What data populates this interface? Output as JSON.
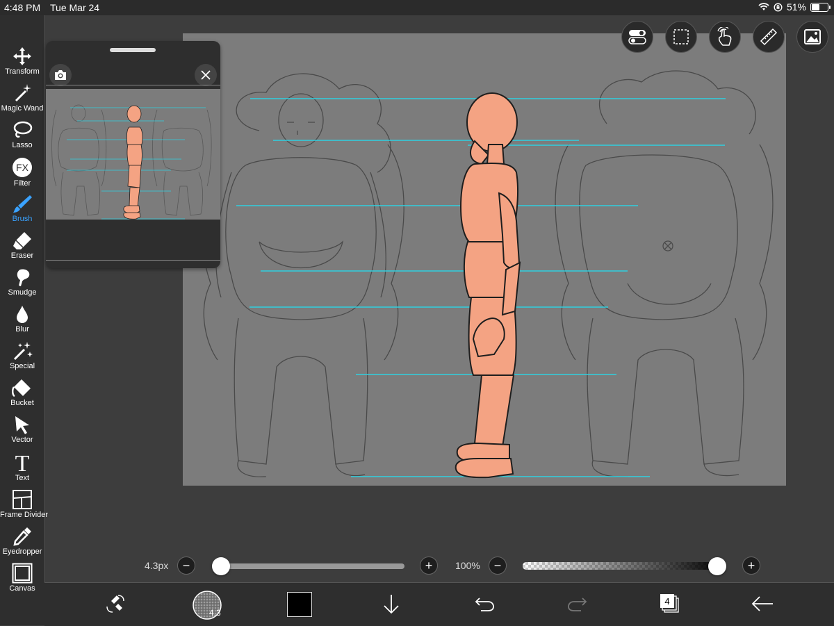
{
  "status": {
    "time": "4:48 PM",
    "date": "Tue Mar 24",
    "battery": "51%"
  },
  "tools": [
    {
      "id": "transform",
      "label": "Transform"
    },
    {
      "id": "magic-wand",
      "label": "Magic Wand"
    },
    {
      "id": "lasso",
      "label": "Lasso"
    },
    {
      "id": "filter",
      "label": "Filter",
      "icon_text": "FX"
    },
    {
      "id": "brush",
      "label": "Brush",
      "active": true
    },
    {
      "id": "eraser",
      "label": "Eraser"
    },
    {
      "id": "smudge",
      "label": "Smudge"
    },
    {
      "id": "blur",
      "label": "Blur"
    },
    {
      "id": "special",
      "label": "Special"
    },
    {
      "id": "bucket",
      "label": "Bucket"
    },
    {
      "id": "vector",
      "label": "Vector"
    },
    {
      "id": "text",
      "label": "Text",
      "icon_text": "T"
    },
    {
      "id": "frame-divider",
      "label": "Frame Divider"
    },
    {
      "id": "eyedropper",
      "label": "Eyedropper"
    },
    {
      "id": "canvas",
      "label": "Canvas"
    }
  ],
  "brush_controls": {
    "size_label": "4.3px",
    "size_fraction": 0.0,
    "opacity_label": "100%",
    "opacity_fraction": 1.0,
    "decrease_symbol": "−",
    "increase_symbol": "+"
  },
  "bottom_bar": {
    "brush_size_badge": "4.3",
    "layer_count": "4",
    "color": "#000000"
  },
  "colors": {
    "accent": "#3aa2ff",
    "guide_lines": "#2fd0e0",
    "figure": "#f4a383",
    "canvas_bg": "#7c7c7c"
  }
}
